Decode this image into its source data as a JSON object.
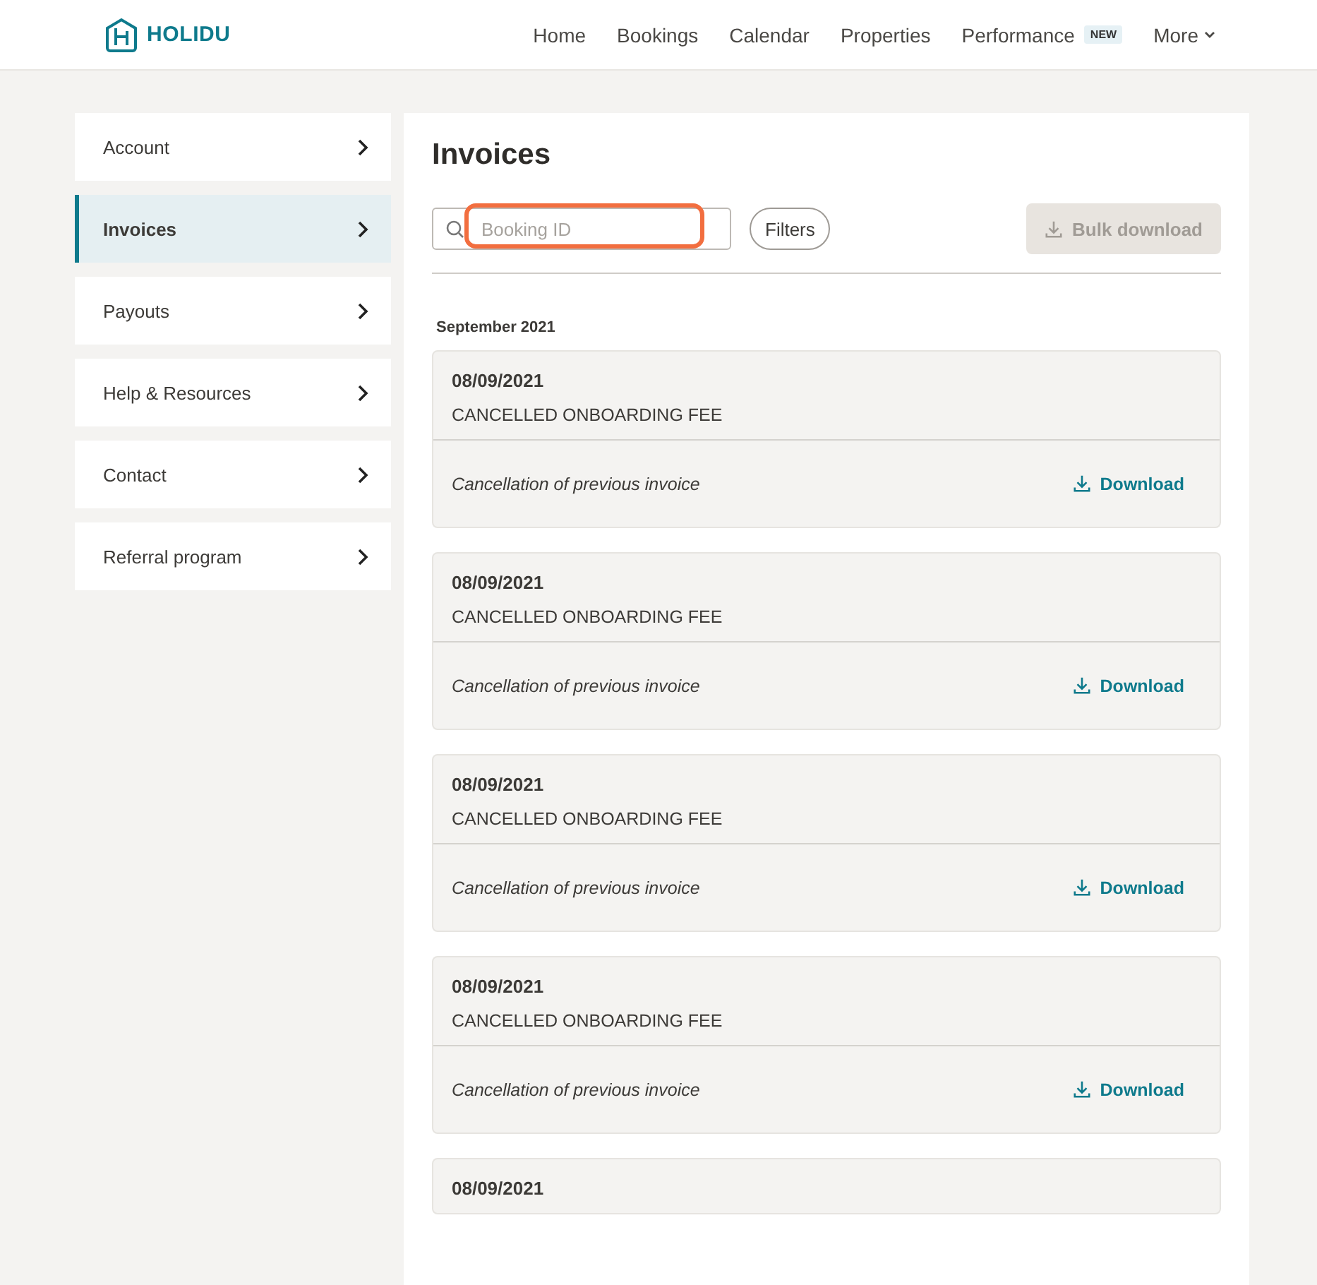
{
  "header": {
    "logo": "HOLIDU",
    "nav": [
      {
        "label": "Home"
      },
      {
        "label": "Bookings"
      },
      {
        "label": "Calendar"
      },
      {
        "label": "Properties"
      },
      {
        "label": "Performance",
        "badge": "NEW"
      },
      {
        "label": "More",
        "dropdown": true
      }
    ]
  },
  "sidebar": {
    "items": [
      {
        "label": "Account",
        "selected": false
      },
      {
        "label": "Invoices",
        "selected": true
      },
      {
        "label": "Payouts",
        "selected": false
      },
      {
        "label": "Help & Resources",
        "selected": false
      },
      {
        "label": "Contact",
        "selected": false
      },
      {
        "label": "Referral program",
        "selected": false
      }
    ]
  },
  "main": {
    "title": "Invoices",
    "search": {
      "placeholder": "Booking ID",
      "highlighted": true
    },
    "filters_button": "Filters",
    "bulk_download": {
      "label": "Bulk download",
      "disabled": true
    },
    "groups": [
      {
        "heading": "September 2021",
        "invoices": [
          {
            "date": "08/09/2021",
            "type": "CANCELLED ONBOARDING FEE",
            "note": "Cancellation of previous invoice",
            "action": "Download"
          },
          {
            "date": "08/09/2021",
            "type": "CANCELLED ONBOARDING FEE",
            "note": "Cancellation of previous invoice",
            "action": "Download"
          },
          {
            "date": "08/09/2021",
            "type": "CANCELLED ONBOARDING FEE",
            "note": "Cancellation of previous invoice",
            "action": "Download"
          },
          {
            "date": "08/09/2021",
            "type": "CANCELLED ONBOARDING FEE",
            "note": "Cancellation of previous invoice",
            "action": "Download"
          },
          {
            "date": "08/09/2021"
          }
        ]
      }
    ]
  }
}
